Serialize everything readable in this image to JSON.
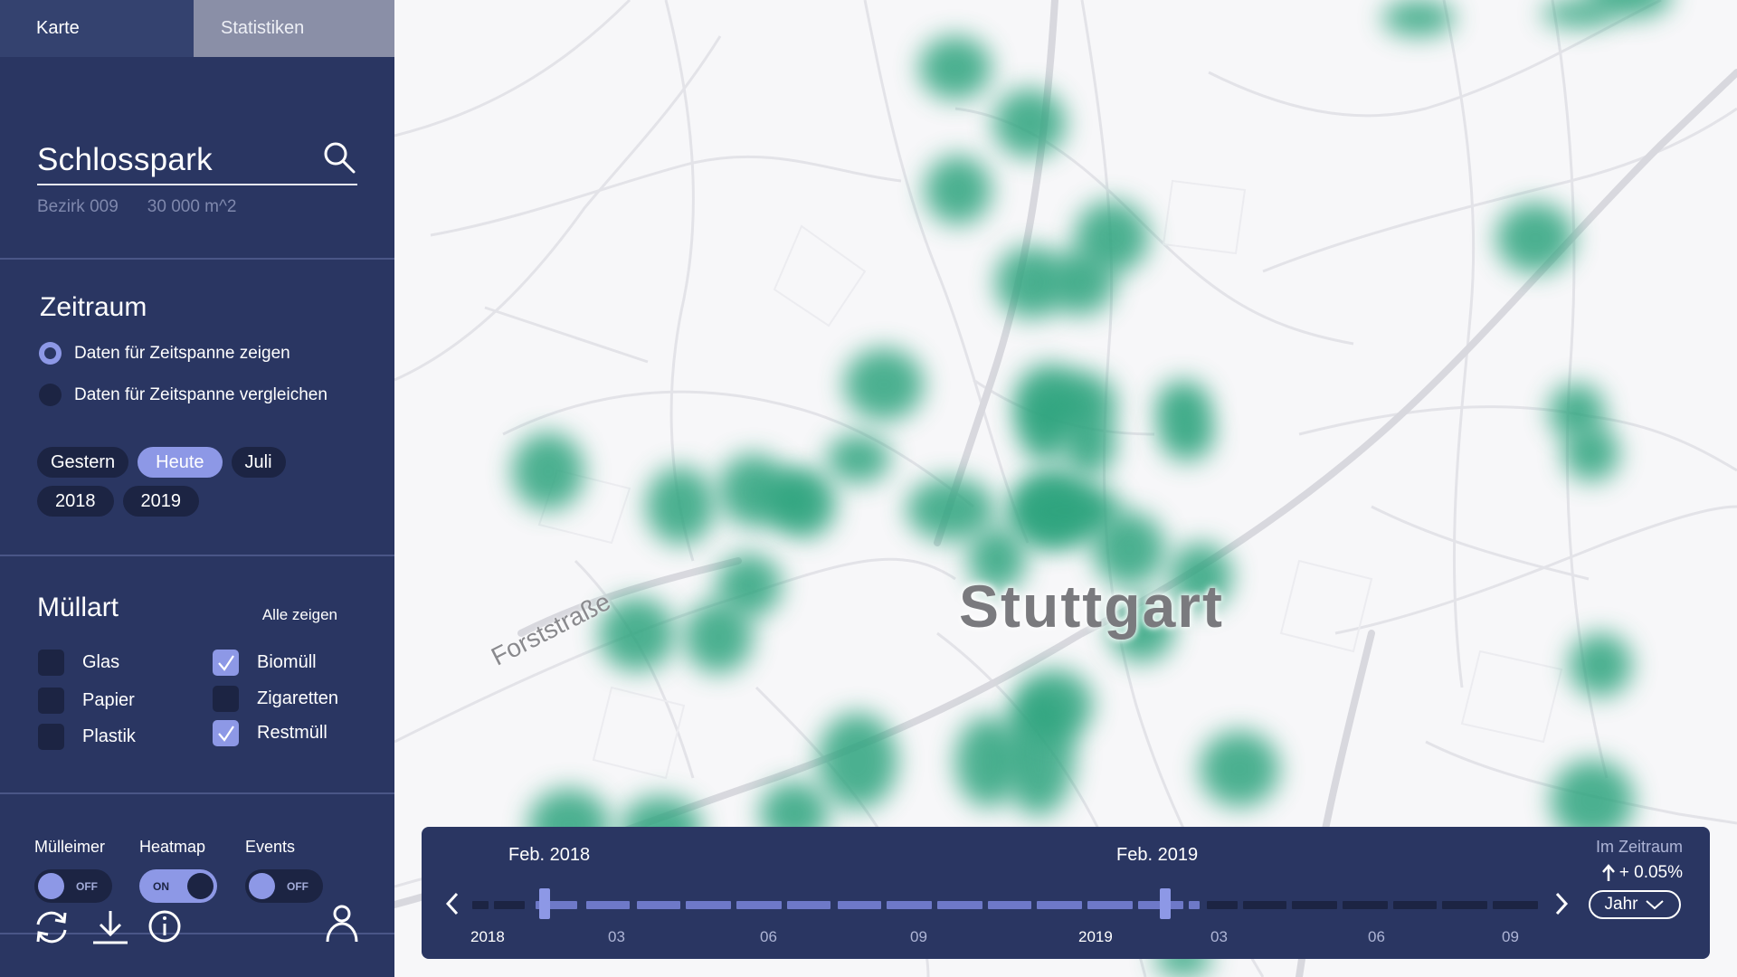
{
  "tabs": [
    {
      "label": "Karte",
      "active": true
    },
    {
      "label": "Statistiken",
      "active": false
    }
  ],
  "search": {
    "value": "Schlosspark",
    "district": "Bezirk 009",
    "area": "30 000 m^2"
  },
  "zeitraum": {
    "title": "Zeitraum",
    "options": [
      {
        "label": "Daten für Zeitspanne zeigen",
        "selected": true
      },
      {
        "label": "Daten für Zeitspanne vergleichen",
        "selected": false
      }
    ],
    "chips": [
      "Gestern",
      "Heute",
      "Juli",
      "2018",
      "2019"
    ],
    "selected_chip": "Heute"
  },
  "muellart": {
    "title": "Müllart",
    "show_all": "Alle zeigen",
    "types": [
      {
        "label": "Glas",
        "checked": false
      },
      {
        "label": "Papier",
        "checked": false
      },
      {
        "label": "Plastik",
        "checked": false
      },
      {
        "label": "Biomüll",
        "checked": true
      },
      {
        "label": "Zigaretten",
        "checked": false
      },
      {
        "label": "Restmüll",
        "checked": true
      }
    ]
  },
  "layers": [
    {
      "label": "Mülleimer",
      "state": "OFF"
    },
    {
      "label": "Heatmap",
      "state": "ON"
    },
    {
      "label": "Events",
      "state": "OFF"
    }
  ],
  "map": {
    "city": "Stuttgart",
    "street": "Forststraße",
    "heat_color": "#2ea47e"
  },
  "timeline": {
    "start_label": "Feb. 2018",
    "end_label": "Feb. 2019",
    "ticks": [
      "2018",
      "03",
      "06",
      "09",
      "2019",
      "03",
      "06",
      "09"
    ],
    "period_label": "Im Zeitraum",
    "change": "+ 0.05%",
    "granularity": "Jahr"
  },
  "colors": {
    "sidebar": "#2a3662",
    "accent": "#8d98e6",
    "dark": "#1c2443"
  }
}
